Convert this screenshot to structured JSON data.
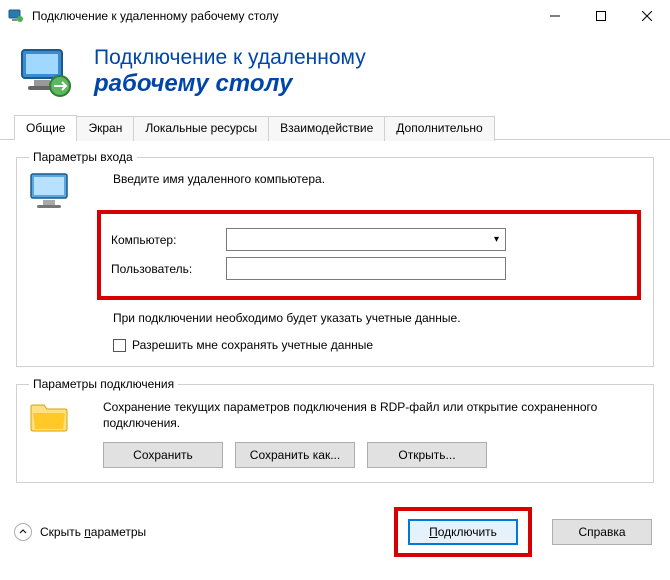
{
  "window": {
    "title": "Подключение к удаленному рабочему столу",
    "minimize": "—",
    "maximize": "☐",
    "close": "✕"
  },
  "banner": {
    "line1": "Подключение к удаленному",
    "line2": "рабочему столу"
  },
  "tabs": {
    "general": "Общие",
    "screen": "Экран",
    "local": "Локальные ресурсы",
    "interaction": "Взаимодействие",
    "advanced": "Дополнительно"
  },
  "login": {
    "legend": "Параметры входа",
    "intro": "Введите имя удаленного компьютера.",
    "computer_label": "Компьютер:",
    "computer_value": "",
    "user_label": "Пользователь:",
    "user_value": "",
    "note": "При подключении необходимо будет указать учетные данные.",
    "save_creds": "Разрешить мне сохранять учетные данные"
  },
  "connection": {
    "legend": "Параметры подключения",
    "desc": "Сохранение текущих параметров подключения в RDP-файл или открытие сохраненного подключения.",
    "save": "Сохранить",
    "save_as": "Сохранить как...",
    "open": "Открыть..."
  },
  "footer": {
    "hide": "Скрыть ",
    "hide_u": "п",
    "hide_rest": "араметры",
    "connect": "Подключить",
    "connect_u": "П",
    "connect_rest": "одключить",
    "help": "Справка"
  }
}
